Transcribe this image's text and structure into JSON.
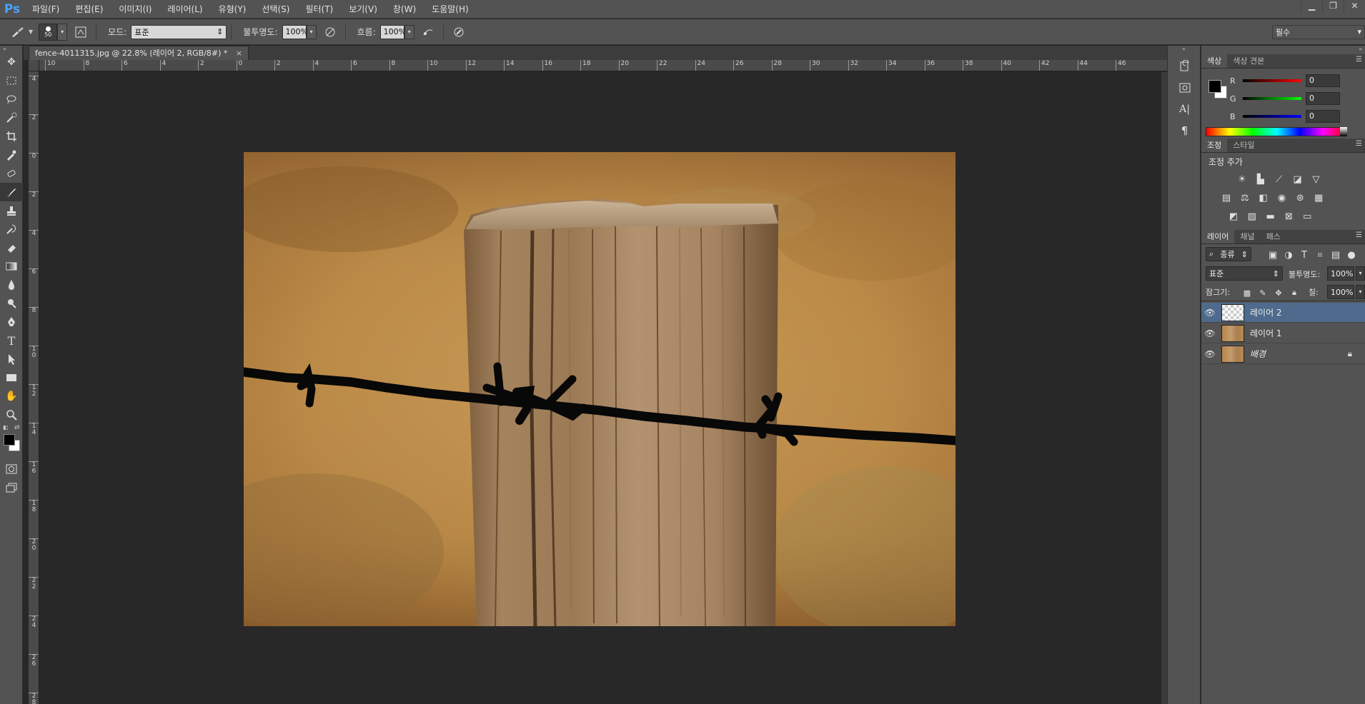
{
  "app": {
    "logo": "Ps"
  },
  "menu": [
    "파일(F)",
    "편집(E)",
    "이미지(I)",
    "레이어(L)",
    "유형(Y)",
    "선택(S)",
    "필터(T)",
    "보기(V)",
    "창(W)",
    "도움말(H)"
  ],
  "window_controls": [
    "▁",
    "❐",
    "✕"
  ],
  "options": {
    "brush_size": "50",
    "mode_label": "모드:",
    "mode_value": "표준",
    "opacity_label": "불투명도:",
    "opacity_value": "100%",
    "flow_label": "흐름:",
    "flow_value": "100%",
    "workspace": "필수"
  },
  "document": {
    "tab_title": "fence-4011315.jpg @ 22.8% (레이어 2, RGB/8#) *",
    "tab_close": "×",
    "h_ruler": [
      "10",
      "8",
      "6",
      "4",
      "2",
      "0",
      "2",
      "4",
      "6",
      "8",
      "10",
      "12",
      "14",
      "16",
      "18",
      "20",
      "22",
      "24",
      "26",
      "28",
      "30",
      "32",
      "34",
      "36",
      "38",
      "40",
      "42",
      "44",
      "46"
    ],
    "v_ruler": [
      "4",
      "2",
      "0",
      "2",
      "4",
      "6",
      "8",
      "1\n0",
      "1\n2",
      "1\n4",
      "1\n6",
      "1\n8",
      "2\n0",
      "2\n2",
      "2\n4",
      "2\n6",
      "2\n8"
    ]
  },
  "color_panel": {
    "tabs": [
      "색상",
      "색상 견본"
    ],
    "r_label": "R",
    "g_label": "G",
    "b_label": "B",
    "r": "0",
    "g": "0",
    "b": "0",
    "foreground": "#000000",
    "background": "#ffffff"
  },
  "adjust_panel": {
    "tabs": [
      "조정",
      "스타일"
    ],
    "heading": "조정 추가"
  },
  "layers_panel": {
    "tabs": [
      "레이어",
      "채널",
      "패스"
    ],
    "filter_kind": "종류",
    "blend_mode": "표준",
    "opacity_label": "불투명도:",
    "opacity_value": "100%",
    "lock_label": "잠그기:",
    "fill_label": "칠:",
    "fill_value": "100%",
    "layers": [
      {
        "name": "레이어 2",
        "selected": true
      },
      {
        "name": "레이어 1",
        "selected": false
      },
      {
        "name": "배경",
        "selected": false,
        "locked": true
      }
    ]
  }
}
